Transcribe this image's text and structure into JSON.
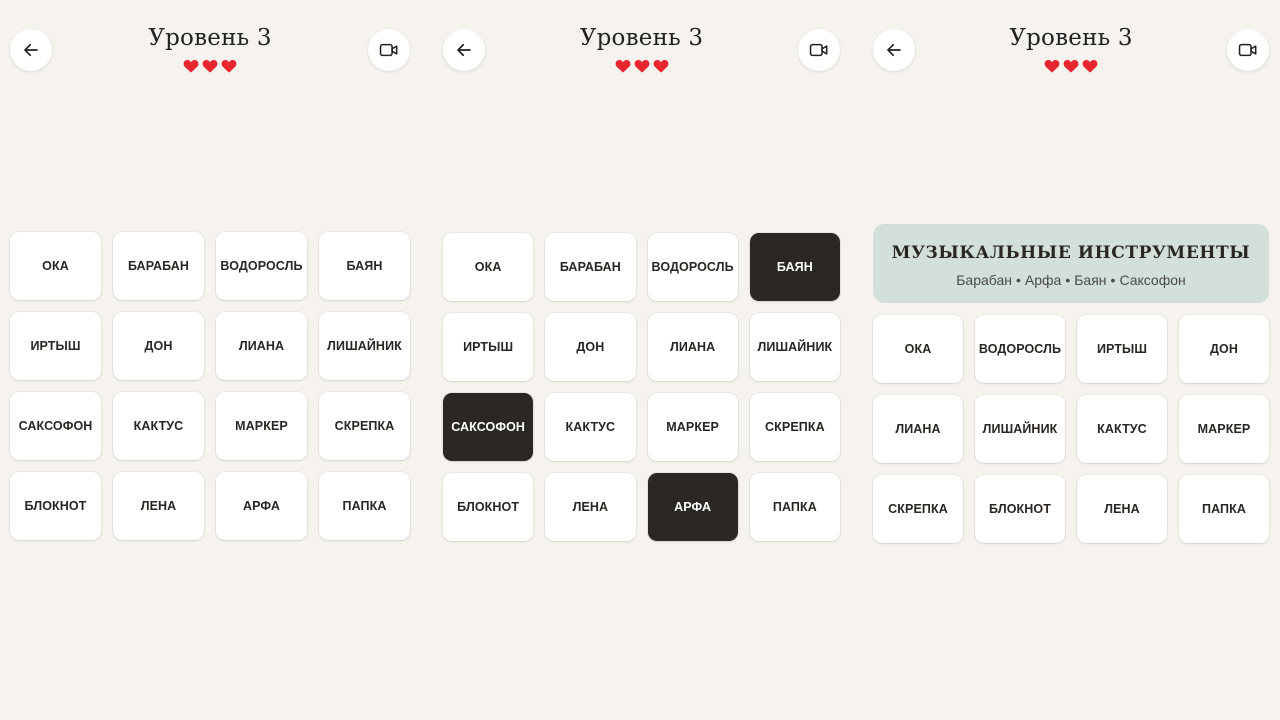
{
  "colors": {
    "background": "#f6f3ef",
    "tile": "#ffffff",
    "tile_selected": "#2b2723",
    "heart": "#e8262f",
    "solved_bg": "#d3e0d9"
  },
  "icons": {
    "back": "arrow-left-icon",
    "video": "video-camera-icon",
    "life": "heart-icon"
  },
  "screens": [
    {
      "title": "Уровень 3",
      "lives": 3,
      "tiles": [
        {
          "label": "ОКА",
          "selected": false
        },
        {
          "label": "БАРАБАН",
          "selected": false
        },
        {
          "label": "ВОДОРОСЛЬ",
          "selected": false
        },
        {
          "label": "БАЯН",
          "selected": false
        },
        {
          "label": "ИРТЫШ",
          "selected": false
        },
        {
          "label": "ДОН",
          "selected": false
        },
        {
          "label": "ЛИАНА",
          "selected": false
        },
        {
          "label": "ЛИШАЙНИК",
          "selected": false
        },
        {
          "label": "САКСОФОН",
          "selected": false
        },
        {
          "label": "КАКТУС",
          "selected": false
        },
        {
          "label": "МАРКЕР",
          "selected": false
        },
        {
          "label": "СКРЕПКА",
          "selected": false
        },
        {
          "label": "БЛОКНОТ",
          "selected": false
        },
        {
          "label": "ЛЕНА",
          "selected": false
        },
        {
          "label": "АРФА",
          "selected": false
        },
        {
          "label": "ПАПКА",
          "selected": false
        }
      ]
    },
    {
      "title": "Уровень 3",
      "lives": 3,
      "tiles": [
        {
          "label": "ОКА",
          "selected": false
        },
        {
          "label": "БАРАБАН",
          "selected": false
        },
        {
          "label": "ВОДОРОСЛЬ",
          "selected": false
        },
        {
          "label": "БАЯН",
          "selected": true
        },
        {
          "label": "ИРТЫШ",
          "selected": false
        },
        {
          "label": "ДОН",
          "selected": false
        },
        {
          "label": "ЛИАНА",
          "selected": false
        },
        {
          "label": "ЛИШАЙНИК",
          "selected": false
        },
        {
          "label": "САКСОФОН",
          "selected": true
        },
        {
          "label": "КАКТУС",
          "selected": false
        },
        {
          "label": "МАРКЕР",
          "selected": false
        },
        {
          "label": "СКРЕПКА",
          "selected": false
        },
        {
          "label": "БЛОКНОТ",
          "selected": false
        },
        {
          "label": "ЛЕНА",
          "selected": false
        },
        {
          "label": "АРФА",
          "selected": true
        },
        {
          "label": "ПАПКА",
          "selected": false
        }
      ]
    },
    {
      "title": "Уровень 3",
      "lives": 3,
      "solved_group": {
        "title": "МУЗЫКАЛЬНЫЕ ИНСТРУМЕНТЫ",
        "words": [
          "Барабан",
          "Арфа",
          "Баян",
          "Саксофон"
        ]
      },
      "tiles": [
        {
          "label": "ОКА",
          "selected": false
        },
        {
          "label": "ВОДОРОСЛЬ",
          "selected": false
        },
        {
          "label": "ИРТЫШ",
          "selected": false
        },
        {
          "label": "ДОН",
          "selected": false
        },
        {
          "label": "ЛИАНА",
          "selected": false
        },
        {
          "label": "ЛИШАЙНИК",
          "selected": false
        },
        {
          "label": "КАКТУС",
          "selected": false
        },
        {
          "label": "МАРКЕР",
          "selected": false
        },
        {
          "label": "СКРЕПКА",
          "selected": false
        },
        {
          "label": "БЛОКНОТ",
          "selected": false
        },
        {
          "label": "ЛЕНА",
          "selected": false
        },
        {
          "label": "ПАПКА",
          "selected": false
        }
      ]
    }
  ]
}
